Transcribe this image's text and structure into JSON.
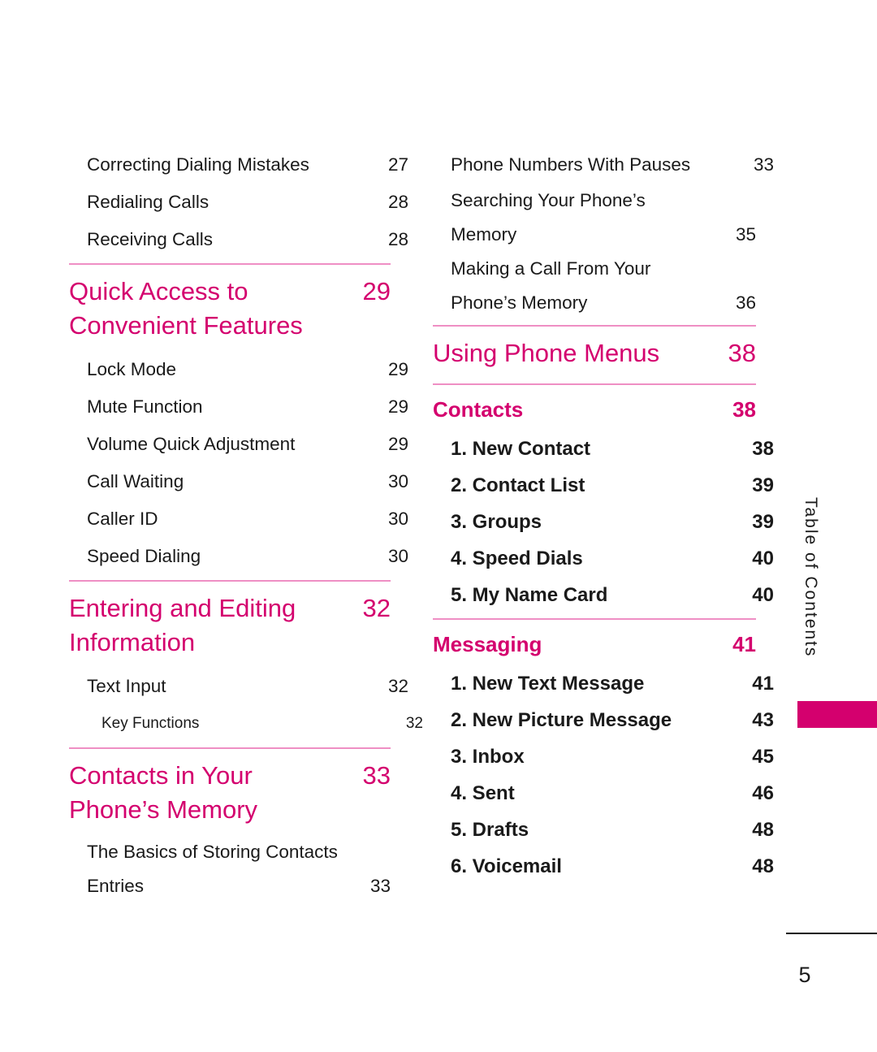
{
  "page": {
    "folio": "5",
    "side_tab_label": "Table of Contents",
    "accent_color": "#D4006E",
    "rule_color": "#EF8FC4"
  },
  "left_column": {
    "entries_top": [
      {
        "label": "Correcting Dialing Mistakes",
        "page": "27"
      },
      {
        "label": "Redialing Calls",
        "page": "28"
      },
      {
        "label": "Receiving Calls",
        "page": "28"
      }
    ],
    "section_quick_access": {
      "title_line1": "Quick Access to Convenient",
      "title_line2": "Features",
      "page": "29",
      "entries": [
        {
          "label": "Lock Mode",
          "page": "29"
        },
        {
          "label": "Mute Function",
          "page": "29"
        },
        {
          "label": "Volume Quick Adjustment",
          "page": "29"
        },
        {
          "label": "Call Waiting",
          "page": "30"
        },
        {
          "label": "Caller ID",
          "page": "30"
        },
        {
          "label": "Speed Dialing",
          "page": "30"
        }
      ]
    },
    "section_entering_editing": {
      "title_line1": "Entering and Editing",
      "title_line2": "Information",
      "page": "32",
      "entries": [
        {
          "label": "Text Input",
          "page": "32"
        },
        {
          "label": "Key Functions",
          "page": "32"
        }
      ]
    },
    "section_contacts_memory": {
      "title_line1": "Contacts in Your Phone’s",
      "title_line2": "Memory",
      "page": "33",
      "entry_wrapped": {
        "line1": "The Basics of Storing Contacts",
        "line2": "Entries",
        "page": "33"
      }
    }
  },
  "right_column": {
    "entries_top": [
      {
        "label": "Phone Numbers With Pauses",
        "page": "33"
      }
    ],
    "entries_wrapped_top": [
      {
        "line1": "Searching Your Phone’s",
        "line2": "Memory",
        "page": "35"
      },
      {
        "line1": "Making a Call From Your",
        "line2": "Phone’s Memory",
        "page": "36"
      }
    ],
    "section_using_phone_menus": {
      "title": "Using Phone Menus",
      "page": "38"
    },
    "section_contacts": {
      "title": "Contacts",
      "page": "38",
      "entries": [
        {
          "label": "1. New Contact",
          "page": "38"
        },
        {
          "label": "2. Contact List",
          "page": "39"
        },
        {
          "label": "3. Groups",
          "page": "39"
        },
        {
          "label": "4. Speed Dials",
          "page": "40"
        },
        {
          "label": "5. My Name Card",
          "page": "40"
        }
      ]
    },
    "section_messaging": {
      "title": "Messaging",
      "page": "41",
      "entries": [
        {
          "label": "1. New Text Message",
          "page": "41"
        },
        {
          "label": "2. New Picture Message",
          "page": "43"
        },
        {
          "label": "3. Inbox",
          "page": "45"
        },
        {
          "label": "4. Sent",
          "page": "46"
        },
        {
          "label": "5. Drafts",
          "page": "48"
        },
        {
          "label": "6. Voicemail",
          "page": "48"
        }
      ]
    }
  }
}
